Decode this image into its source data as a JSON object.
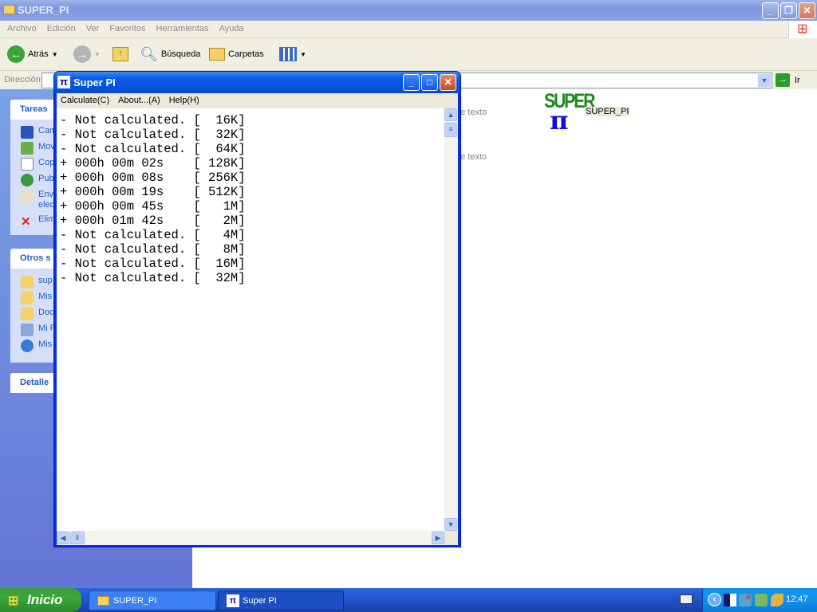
{
  "explorer": {
    "title": "SUPER_PI",
    "menu": [
      "Archivo",
      "Edición",
      "Ver",
      "Favoritos",
      "Herramientas",
      "Ayuda"
    ],
    "toolbar": {
      "back": "Atrás",
      "search": "Búsqueda",
      "folders": "Carpetas"
    },
    "address_label": "Dirección",
    "go": "Ir",
    "left_panels": {
      "tasks_title": "Tareas",
      "tasks": [
        "Cam",
        "Mov",
        "Cop",
        "Pub",
        "Env\nelec",
        "Elim"
      ],
      "other_title": "Otros s",
      "other": [
        "sup",
        "Mis",
        "Doc",
        "Mi P",
        "Mis"
      ],
      "details_title": "Detalle"
    },
    "content": {
      "file_type_1": "de texto",
      "file_type_2": "de texto",
      "icon_logo": "SUPER",
      "file_name": "SUPER_PI"
    }
  },
  "superpi": {
    "title": "Super PI",
    "menu": [
      "Calculate(C)",
      "About...(A)",
      "Help(H)"
    ],
    "lines": [
      "- Not calculated. [  16K]",
      "- Not calculated. [  32K]",
      "- Not calculated. [  64K]",
      "+ 000h 00m 02s    [ 128K]",
      "+ 000h 00m 08s    [ 256K]",
      "+ 000h 00m 19s    [ 512K]",
      "+ 000h 00m 45s    [   1M]",
      "+ 000h 01m 42s    [   2M]",
      "- Not calculated. [   4M]",
      "- Not calculated. [   8M]",
      "- Not calculated. [  16M]",
      "- Not calculated. [  32M]"
    ]
  },
  "taskbar": {
    "start": "Inicio",
    "tasks": [
      "SUPER_PI",
      "Super PI"
    ],
    "clock": "12:47"
  }
}
